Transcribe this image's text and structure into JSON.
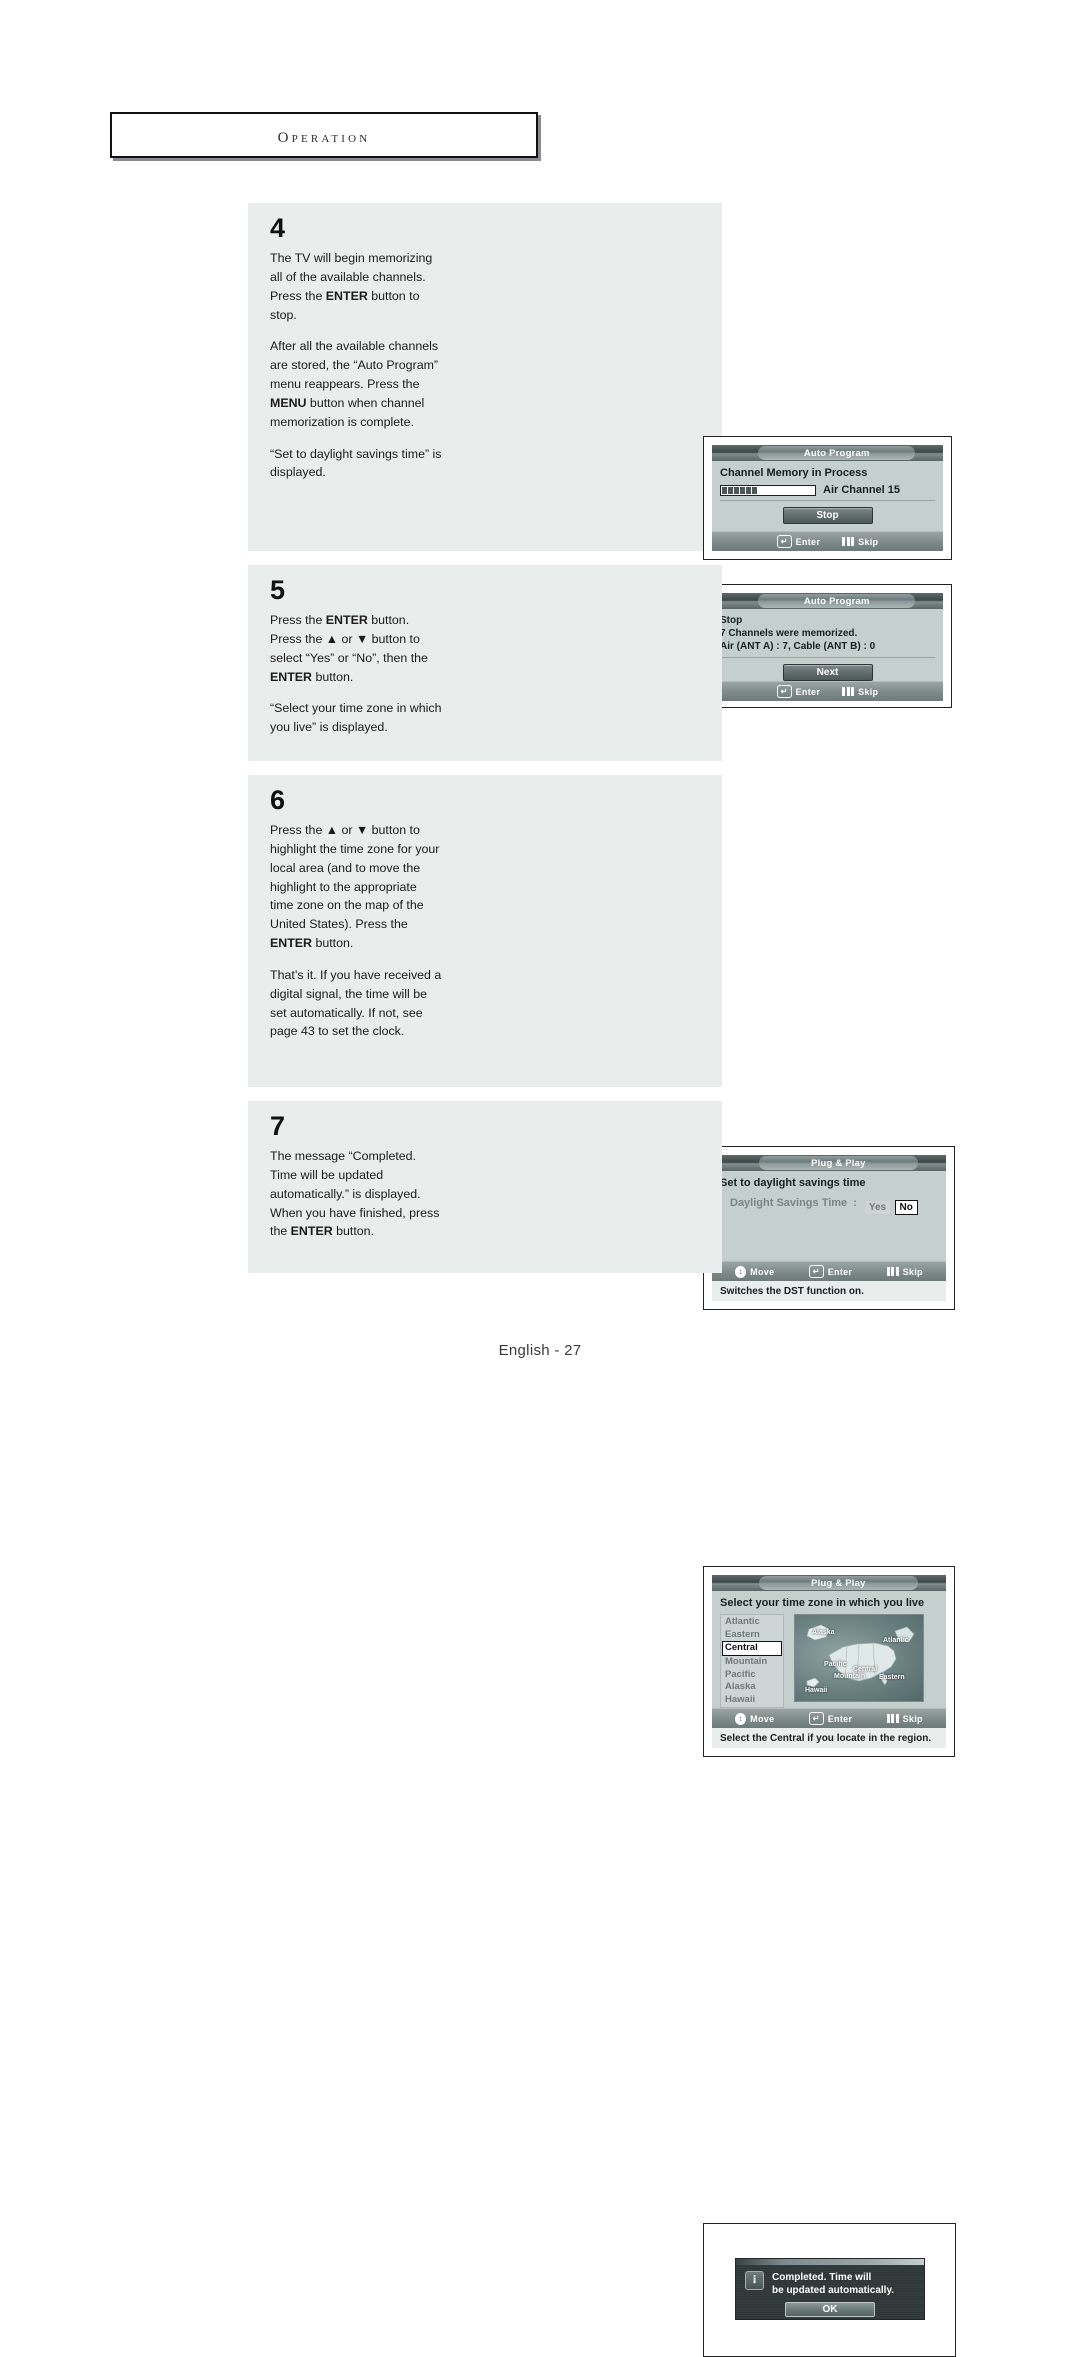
{
  "header": {
    "title": "Operation"
  },
  "footer": {
    "text": "English - 27"
  },
  "steps": [
    {
      "number": "4",
      "paragraphs": [
        "The TV will begin memorizing all of the available channels. Press the ENTER button to stop.",
        "After all the available channels are stored, the “Auto Program” menu reappears. Press the MENU button when channel memorization is complete.",
        "“Set to daylight savings time” is displayed."
      ]
    },
    {
      "number": "5",
      "paragraphs": [
        "Press the ENTER button. Press the ▲ or ▼ button to select “Yes” or “No”, then the ENTER button.",
        "“Select your time zone in which you live” is displayed."
      ]
    },
    {
      "number": "6",
      "paragraphs": [
        "Press the ▲ or ▼ button to highlight the time zone for your local area (and to move the highlight to the appropriate time zone on the map of the United States). Press the ENTER button.",
        "That’s it. If you have received a digital signal, the time will be set automatically. If not, see page 43 to set the clock."
      ]
    },
    {
      "number": "7",
      "paragraphs": [
        "The message “Completed. Time will be updated automatically.” is displayed. When you have finished, press the ENTER button."
      ]
    }
  ],
  "screen_4a": {
    "title": "Auto Program",
    "heading": "Channel Memory in Process",
    "progress_label": "Air Channel  15",
    "progress_segments": 6,
    "progress_total_segments": 16,
    "button": "Stop",
    "hints": [
      {
        "icon": "enter-icon",
        "label": "Enter"
      },
      {
        "icon": "skip-icon",
        "label": "Skip"
      }
    ]
  },
  "screen_4b": {
    "title": "Auto Program",
    "lines": [
      "Stop",
      "7 Channels were memorized.",
      "Air (ANT A) : 7, Cable (ANT B) : 0"
    ],
    "button": "Next",
    "hints": [
      {
        "icon": "enter-icon",
        "label": "Enter"
      },
      {
        "icon": "skip-icon",
        "label": "Skip"
      }
    ]
  },
  "screen_5": {
    "title": "Plug & Play",
    "heading": "Set to daylight  savings time",
    "field_label": "Daylight Savings Time",
    "field_colon": ":",
    "options": [
      {
        "label": "Yes",
        "selected": false
      },
      {
        "label": "No",
        "selected": true
      }
    ],
    "hints": [
      {
        "icon": "move-icon",
        "label": "Move"
      },
      {
        "icon": "enter-icon",
        "label": "Enter"
      },
      {
        "icon": "skip-icon",
        "label": "Skip"
      }
    ],
    "caption": "Switches the DST function on."
  },
  "screen_6": {
    "title": "Plug & Play",
    "heading": "Select your time zone in which you live",
    "timezones": [
      {
        "label": "Atlantic",
        "selected": false
      },
      {
        "label": "Eastern",
        "selected": false
      },
      {
        "label": "Central",
        "selected": true
      },
      {
        "label": "Mountain",
        "selected": false
      },
      {
        "label": "Pacific",
        "selected": false
      },
      {
        "label": "Alaska",
        "selected": false
      },
      {
        "label": "Hawaii",
        "selected": false
      }
    ],
    "map_labels": [
      "Alaska",
      "Atlantic",
      "Pacific",
      "Central",
      "Mountain",
      "Eastern",
      "Hawaii"
    ],
    "hints": [
      {
        "icon": "move-icon",
        "label": "Move"
      },
      {
        "icon": "enter-icon",
        "label": "Enter"
      },
      {
        "icon": "skip-icon",
        "label": "Skip"
      }
    ],
    "caption": "Select the Central  if you locate in the region."
  },
  "screen_7": {
    "message_line1": "Completed. Time will",
    "message_line2": "be updated automatically.",
    "button": "OK",
    "info_glyph": "i"
  }
}
